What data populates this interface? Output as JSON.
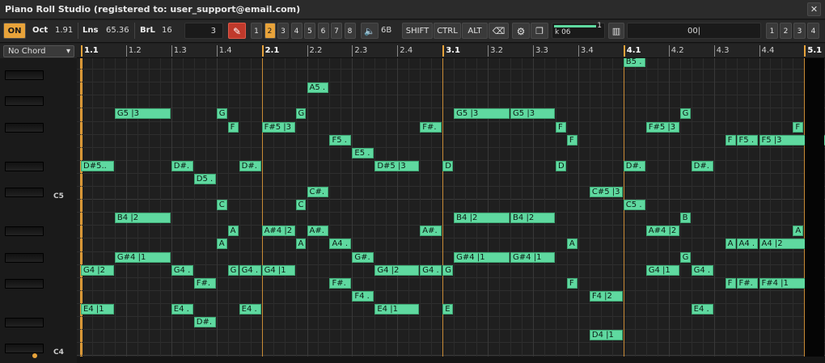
{
  "app": {
    "title": "Piano Roll Studio  (registered to: user_support@email.com)",
    "close_glyph": "✕"
  },
  "toolbar": {
    "on_label": "ON",
    "oct_label": "Oct",
    "oct_value": "1.91",
    "lns_label": "Lns",
    "lns_value": "65.36",
    "brl_label": "BrL",
    "brl_value": "16",
    "field_value": "3",
    "voices": [
      "1",
      "2",
      "3",
      "4",
      "5",
      "6",
      "7",
      "8"
    ],
    "active_voice": "2",
    "volume_value": "6B",
    "shift_label": "SHIFT",
    "ctrl_label": "CTRL",
    "alt_label": "ALT",
    "slider_text": "k 06",
    "slider_value": "1",
    "slider_level": 0.85,
    "input_value": "00|",
    "tracks": [
      "1",
      "2",
      "3",
      "4"
    ],
    "icons": {
      "pen": "pencil-icon",
      "speaker": "speaker-icon",
      "eraser": "eraser-icon",
      "gear": "gear-icon",
      "window": "window-icon",
      "keys": "piano-icon"
    }
  },
  "chord_select": {
    "value": "No Chord",
    "arrow": "▾"
  },
  "keyboard": {
    "c5_label": "C5",
    "c4_label": "C4"
  },
  "ruler": {
    "ticks": [
      "1.1",
      "1.2",
      "1.3",
      "1.4",
      "2.1",
      "2.2",
      "2.3",
      "2.4",
      "3.1",
      "3.2",
      "3.3",
      "3.4",
      "4.1",
      "4.2",
      "4.3",
      "4.4",
      "5.1"
    ]
  },
  "notes": [
    {
      "label": "B5 .",
      "pitch": "B5",
      "start": 12.0,
      "len": 0.5
    },
    {
      "label": "A5 .",
      "pitch": "A5",
      "start": 5.0,
      "len": 0.5
    },
    {
      "label": "G",
      "pitch": "G5",
      "start": 3.0,
      "len": 0.25
    },
    {
      "label": "G",
      "pitch": "G5",
      "start": 4.75,
      "len": 0.25
    },
    {
      "label": "G5 |3",
      "pitch": "G5",
      "start": 0.75,
      "len": 1.25
    },
    {
      "label": "G5 |3",
      "pitch": "G5",
      "start": 8.25,
      "len": 1.25
    },
    {
      "label": "G5 |3",
      "pitch": "G5",
      "start": 9.5,
      "len": 1.0
    },
    {
      "label": "G",
      "pitch": "G5",
      "start": 13.25,
      "len": 0.25
    },
    {
      "label": "F",
      "pitch": "F#5",
      "start": 3.25,
      "len": 0.25
    },
    {
      "label": "F#5 |3",
      "pitch": "F#5",
      "start": 4.0,
      "len": 0.75
    },
    {
      "label": "F#.",
      "pitch": "F#5",
      "start": 7.5,
      "len": 0.5
    },
    {
      "label": "F",
      "pitch": "F#5",
      "start": 10.5,
      "len": 0.25
    },
    {
      "label": "F#5 |3",
      "pitch": "F#5",
      "start": 12.5,
      "len": 0.75
    },
    {
      "label": "F",
      "pitch": "F#5",
      "start": 15.75,
      "len": 0.25
    },
    {
      "label": "F5 .",
      "pitch": "F5",
      "start": 5.5,
      "len": 0.5
    },
    {
      "label": "F",
      "pitch": "F5",
      "start": 10.75,
      "len": 0.25
    },
    {
      "label": "F",
      "pitch": "F5",
      "start": 14.25,
      "len": 0.25
    },
    {
      "label": "F5 .",
      "pitch": "F5",
      "start": 14.5,
      "len": 0.5
    },
    {
      "label": "F5 |3",
      "pitch": "F5",
      "start": 15.0,
      "len": 1.5
    },
    {
      "label": "E5 .",
      "pitch": "E5",
      "start": 6.0,
      "len": 0.5
    },
    {
      "label": "D#5..",
      "pitch": "D#5",
      "start": 0.0,
      "len": 0.75
    },
    {
      "label": "D#.",
      "pitch": "D#5",
      "start": 2.0,
      "len": 0.5
    },
    {
      "label": "D#.",
      "pitch": "D#5",
      "start": 3.5,
      "len": 0.5
    },
    {
      "label": "D#5 |3",
      "pitch": "D#5",
      "start": 6.5,
      "len": 1.0
    },
    {
      "label": "D",
      "pitch": "D#5",
      "start": 8.0,
      "len": 0.25
    },
    {
      "label": "D",
      "pitch": "D#5",
      "start": 10.5,
      "len": 0.25
    },
    {
      "label": "D#.",
      "pitch": "D#5",
      "start": 12.0,
      "len": 0.5
    },
    {
      "label": "D#.",
      "pitch": "D#5",
      "start": 13.5,
      "len": 0.5
    },
    {
      "label": "D5 .",
      "pitch": "D5",
      "start": 2.5,
      "len": 0.5
    },
    {
      "label": "C#.",
      "pitch": "C#5",
      "start": 5.0,
      "len": 0.5
    },
    {
      "label": "C#5 |3",
      "pitch": "C#5",
      "start": 11.25,
      "len": 0.75
    },
    {
      "label": "C",
      "pitch": "C5",
      "start": 3.0,
      "len": 0.25
    },
    {
      "label": "C",
      "pitch": "C5",
      "start": 4.75,
      "len": 0.25
    },
    {
      "label": "C5 .",
      "pitch": "C5",
      "start": 12.0,
      "len": 0.5
    },
    {
      "label": "B4 |2",
      "pitch": "B4",
      "start": 0.75,
      "len": 1.25
    },
    {
      "label": "B4 |2",
      "pitch": "B4",
      "start": 8.25,
      "len": 1.25
    },
    {
      "label": "B4 |2",
      "pitch": "B4",
      "start": 9.5,
      "len": 1.0
    },
    {
      "label": "B",
      "pitch": "B4",
      "start": 13.25,
      "len": 0.25
    },
    {
      "label": "A",
      "pitch": "A#4",
      "start": 3.25,
      "len": 0.25
    },
    {
      "label": "A#4 |2",
      "pitch": "A#4",
      "start": 4.0,
      "len": 0.75
    },
    {
      "label": "A#.",
      "pitch": "A#4",
      "start": 5.0,
      "len": 0.5
    },
    {
      "label": "A#.",
      "pitch": "A#4",
      "start": 7.5,
      "len": 0.5
    },
    {
      "label": "A#4 |2",
      "pitch": "A#4",
      "start": 12.5,
      "len": 0.75
    },
    {
      "label": "A",
      "pitch": "A#4",
      "start": 15.75,
      "len": 0.25
    },
    {
      "label": "A",
      "pitch": "A4",
      "start": 3.0,
      "len": 0.25
    },
    {
      "label": "A",
      "pitch": "A4",
      "start": 4.75,
      "len": 0.25
    },
    {
      "label": "A4 .",
      "pitch": "A4",
      "start": 5.5,
      "len": 0.5
    },
    {
      "label": "A",
      "pitch": "A4",
      "start": 10.75,
      "len": 0.25
    },
    {
      "label": "A",
      "pitch": "A4",
      "start": 14.25,
      "len": 0.25
    },
    {
      "label": "A4 .",
      "pitch": "A4",
      "start": 14.5,
      "len": 0.5
    },
    {
      "label": "A4 |2",
      "pitch": "A4",
      "start": 15.0,
      "len": 1.25
    },
    {
      "label": "G#4 |1",
      "pitch": "G#4",
      "start": 0.75,
      "len": 1.25
    },
    {
      "label": "G#.",
      "pitch": "G#4",
      "start": 6.0,
      "len": 0.5
    },
    {
      "label": "G#4 |1",
      "pitch": "G#4",
      "start": 8.25,
      "len": 1.25
    },
    {
      "label": "G#4 |1",
      "pitch": "G#4",
      "start": 9.5,
      "len": 1.0
    },
    {
      "label": "G",
      "pitch": "G#4",
      "start": 13.25,
      "len": 0.25
    },
    {
      "label": "G4 |2",
      "pitch": "G4",
      "start": 0.0,
      "len": 0.75
    },
    {
      "label": "G4 .",
      "pitch": "G4",
      "start": 2.0,
      "len": 0.5
    },
    {
      "label": "G",
      "pitch": "G4",
      "start": 3.25,
      "len": 0.25
    },
    {
      "label": "G4 .",
      "pitch": "G4",
      "start": 3.5,
      "len": 0.5
    },
    {
      "label": "G4 |1",
      "pitch": "G4",
      "start": 4.0,
      "len": 0.75
    },
    {
      "label": "G4 |2",
      "pitch": "G4",
      "start": 6.5,
      "len": 1.0
    },
    {
      "label": "G4 .",
      "pitch": "G4",
      "start": 7.5,
      "len": 0.5
    },
    {
      "label": "G",
      "pitch": "G4",
      "start": 8.0,
      "len": 0.25
    },
    {
      "label": "G4 |1",
      "pitch": "G4",
      "start": 12.5,
      "len": 0.75
    },
    {
      "label": "G4 .",
      "pitch": "G4",
      "start": 13.5,
      "len": 0.5
    },
    {
      "label": "F#.",
      "pitch": "F#4",
      "start": 2.5,
      "len": 0.5
    },
    {
      "label": "F#.",
      "pitch": "F#4",
      "start": 5.5,
      "len": 0.5
    },
    {
      "label": "F",
      "pitch": "F#4",
      "start": 10.75,
      "len": 0.25
    },
    {
      "label": "F",
      "pitch": "F#4",
      "start": 14.25,
      "len": 0.25
    },
    {
      "label": "F#.",
      "pitch": "F#4",
      "start": 14.5,
      "len": 0.5
    },
    {
      "label": "F#4 |1",
      "pitch": "F#4",
      "start": 15.0,
      "len": 1.25
    },
    {
      "label": "F4 .",
      "pitch": "F4",
      "start": 6.0,
      "len": 0.5
    },
    {
      "label": "F4 |2",
      "pitch": "F4",
      "start": 11.25,
      "len": 0.75
    },
    {
      "label": "E4 |1",
      "pitch": "E4",
      "start": 0.0,
      "len": 0.75
    },
    {
      "label": "E4 .",
      "pitch": "E4",
      "start": 2.0,
      "len": 0.5
    },
    {
      "label": "E4 .",
      "pitch": "E4",
      "start": 3.5,
      "len": 0.5
    },
    {
      "label": "E4 |1",
      "pitch": "E4",
      "start": 6.5,
      "len": 1.0
    },
    {
      "label": "E",
      "pitch": "E4",
      "start": 8.0,
      "len": 0.25
    },
    {
      "label": "E4 .",
      "pitch": "E4",
      "start": 13.5,
      "len": 0.5
    },
    {
      "label": "D#.",
      "pitch": "D#4",
      "start": 2.5,
      "len": 0.5
    },
    {
      "label": "D4 |1",
      "pitch": "D4",
      "start": 11.25,
      "len": 0.75
    }
  ],
  "colors": {
    "note": "#5fd9a0",
    "bar_line": "#c98b35",
    "active_voice": "#e8a33a"
  }
}
